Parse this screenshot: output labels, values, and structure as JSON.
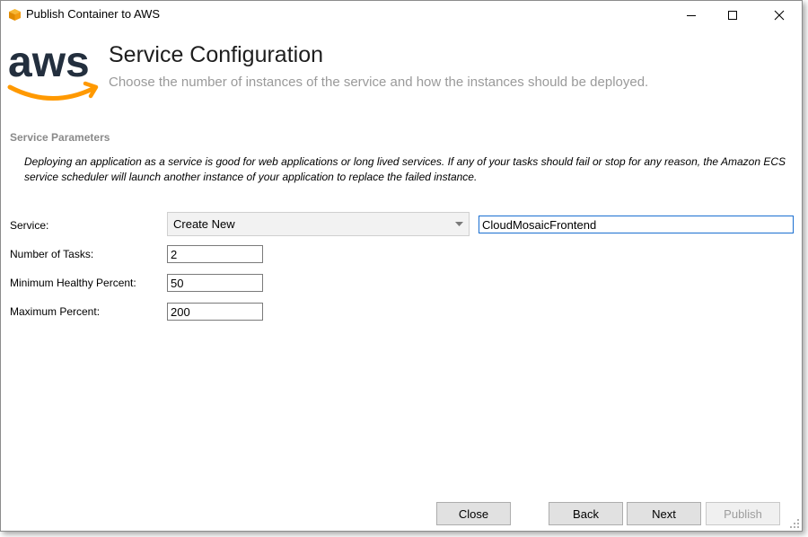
{
  "window": {
    "title": "Publish Container to AWS"
  },
  "header": {
    "logo_text": "aws",
    "title": "Service Configuration",
    "subtitle": "Choose the number of instances of the service and how the instances should be deployed."
  },
  "section": {
    "label": "Service Parameters",
    "description": "Deploying an application as a service is good for web applications or long lived services. If any of your tasks should fail or stop for any reason, the Amazon ECS service scheduler will launch another instance of your application to replace the failed instance."
  },
  "form": {
    "service_label": "Service:",
    "service_selected": "Create New",
    "service_name": "CloudMosaicFrontend",
    "tasks_label": "Number of Tasks:",
    "tasks_value": "2",
    "min_healthy_label": "Minimum Healthy Percent:",
    "min_healthy_value": "50",
    "max_percent_label": "Maximum Percent:",
    "max_percent_value": "200"
  },
  "buttons": {
    "close": "Close",
    "back": "Back",
    "next": "Next",
    "publish": "Publish"
  },
  "colors": {
    "aws_orange": "#ff9900",
    "aws_dark": "#232f3e",
    "focus_blue": "#1a6fd1"
  }
}
